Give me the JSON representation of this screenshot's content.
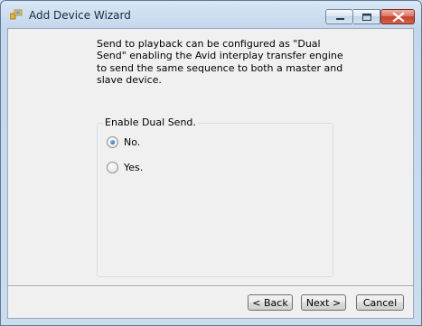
{
  "window": {
    "title": "Add Device Wizard"
  },
  "icons": {
    "app": "device-wizard-icon",
    "minimize": "minimize-icon",
    "maximize": "maximize-icon",
    "close": "close-icon"
  },
  "content": {
    "description": "Send to playback can be configured as \"Dual Send\" enabling the Avid interplay transfer engine to send the same sequence to both a master and slave device."
  },
  "group": {
    "label": "Enable Dual Send.",
    "options": [
      {
        "label": "No.",
        "selected": true
      },
      {
        "label": "Yes.",
        "selected": false
      }
    ]
  },
  "buttons": {
    "back": "< Back",
    "next": "Next >",
    "cancel": "Cancel"
  },
  "colors": {
    "titlebar": "#c4d7ec",
    "close_button": "#c8412b",
    "radio_selected": "#2e6db8"
  }
}
